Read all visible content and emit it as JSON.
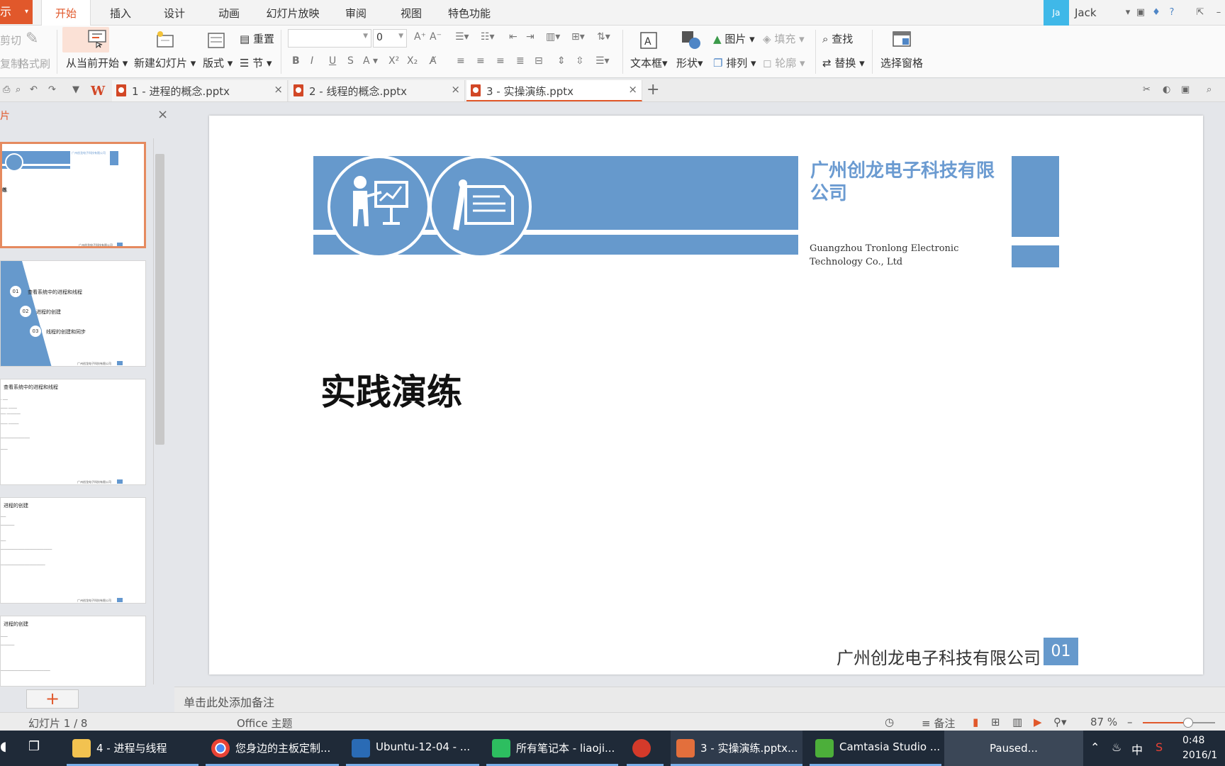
{
  "app": {
    "button_label": "示",
    "menu_tabs": [
      "开始",
      "插入",
      "设计",
      "动画",
      "幻灯片放映",
      "审阅",
      "视图",
      "特色功能"
    ],
    "active_tab": "开始"
  },
  "user": {
    "avatar_text": "Ja",
    "name": "Jack"
  },
  "ribbon": {
    "cut": "剪切",
    "copy": "复制",
    "format_painter": "格式刷",
    "from_current": "从当前开始",
    "new_slide": "新建幻灯片",
    "layout": "版式",
    "reset": "重置",
    "section": "节",
    "font_name": "",
    "font_size": "0",
    "textbox": "文本框",
    "shape": "形状",
    "picture": "图片",
    "fill": "填充",
    "arrange": "排列",
    "outline": "轮廓",
    "find": "查找",
    "replace": "替换",
    "select_pane": "选择窗格"
  },
  "doc_tabs": [
    {
      "title": "1 - 进程的概念.pptx"
    },
    {
      "title": "2 - 线程的概念.pptx"
    },
    {
      "title": "3 - 实操演练.pptx"
    }
  ],
  "panel": {
    "title": "片",
    "thumbs": {
      "t1_company": "广州创龙电子科技有限公司",
      "t1_title": "练",
      "t2_items": [
        {
          "num": "01",
          "text": "查看系统中的进程和线程"
        },
        {
          "num": "02",
          "text": "进程的创建"
        },
        {
          "num": "03",
          "text": "线程的创建和同步"
        }
      ],
      "t3_title": "查看系统中的进程和线程",
      "t4_title": "进程的创建",
      "t5_title": "进程的创建",
      "footer": "广州创龙电子科技有限公司"
    },
    "add_label": "+"
  },
  "slide": {
    "company_cn": "广州创龙电子科技有限公司",
    "company_en": "Guangzhou Tronlong Electronic Technology Co., Ltd",
    "title": "实践演练",
    "footer_company": "广州创龙电子科技有限公司",
    "footer_number": "01",
    "accent": "#6699CC"
  },
  "notes_placeholder": "单击此处添加备注",
  "status": {
    "slide_counter": "幻灯片 1 / 8",
    "theme": "Office 主题",
    "notes": "备注",
    "zoom": "87 %",
    "zoom_fraction": 0.87
  },
  "taskbar": {
    "items": [
      "4 - 进程与线程",
      "您身边的主板定制...",
      "Ubuntu-12-04 - ...",
      "所有笔记本 - liaoji...",
      "3 - 实操演练.pptx...",
      "Camtasia Studio ..."
    ],
    "paused": "Paused...",
    "ime": "中",
    "time": "0:48",
    "date": "2016/1"
  }
}
